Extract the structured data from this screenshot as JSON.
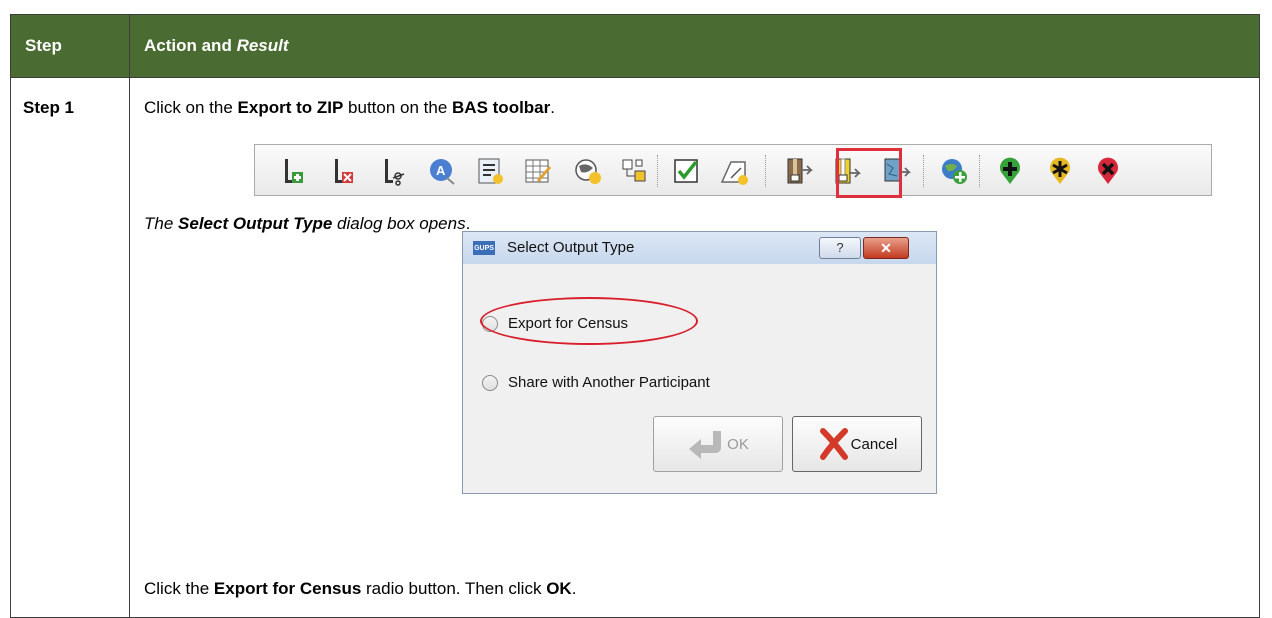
{
  "header": {
    "step": "Step",
    "action_pre": "Action and ",
    "action_result": "Result"
  },
  "row": {
    "step": "Step 1",
    "line1": {
      "a": "Click on the ",
      "b": "Export to ZIP",
      "c": " button on the ",
      "d": "BAS toolbar",
      "e": "."
    },
    "line2": {
      "a": "The ",
      "b": "Select Output Type",
      "c": " dialog box opens",
      "d": "."
    },
    "line3": {
      "a": "Click the ",
      "b": "Export for Census",
      "c": " radio button. Then click ",
      "d": "OK",
      "e": "."
    }
  },
  "toolbar": {
    "icons": [
      "add-line-icon",
      "delete-line-icon",
      "split-line-icon",
      "address-point-icon",
      "new-form-icon",
      "edit-table-icon",
      "globe-person-icon",
      "topology-icon",
      "validate-icon",
      "new-polygon-icon",
      "import-zip-icon",
      "export-zip-icon",
      "export-shapefile-icon",
      "add-layer-icon",
      "add-point-icon",
      "modify-point-icon",
      "delete-point-icon"
    ],
    "highlight": "export-zip-icon"
  },
  "dialog": {
    "logo": "GUPS",
    "title": "Select Output Type",
    "help": "?",
    "close": "✕",
    "options": [
      "Export for Census",
      "Share with Another Participant"
    ],
    "ok": "OK",
    "cancel": "Cancel"
  },
  "colors": {
    "header_bg": "#4a6b32",
    "highlight": "#e02f3c"
  }
}
